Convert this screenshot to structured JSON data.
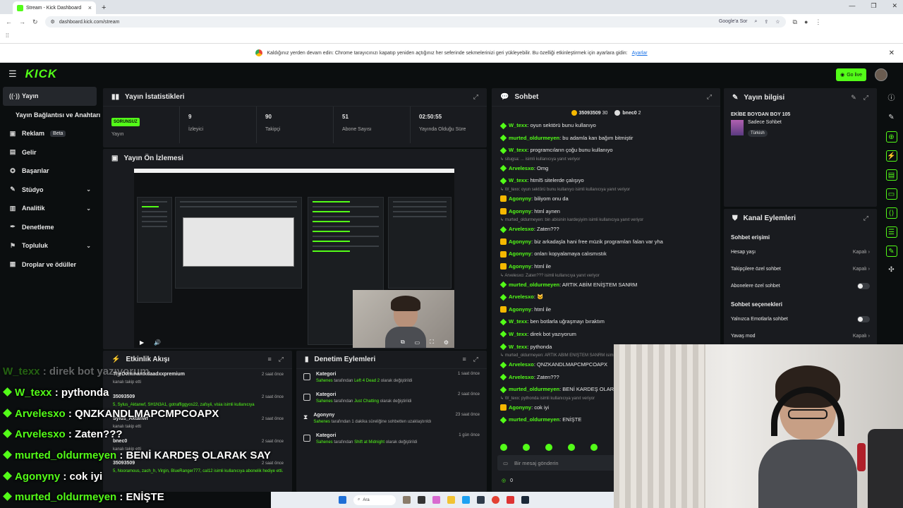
{
  "browser": {
    "tab_title": "Stream - Kick Dashboard",
    "url": "dashboard.kick.com/stream",
    "translate_label": "Google'a Sor",
    "info_text": "Kaldığınız yerden devam edin: Chrome tarayıcınızı kapatıp yeniden açtığınız her seferinde sekmelerinizi geri yükleyebilir. Bu özelliği etkinleştirmek için ayarlara gidin:",
    "info_link": "Ayarlar"
  },
  "topbar": {
    "logo": "KICK",
    "golive_label": "Go live"
  },
  "sidebar": {
    "items": [
      {
        "label": "Yayın",
        "icon": "broadcast-icon"
      },
      {
        "label": "Yayın Bağlantısı ve Anahtarı"
      },
      {
        "label": "Reklam",
        "badge": "Beta",
        "icon": "ads-icon"
      },
      {
        "label": "Gelir",
        "icon": "revenue-icon"
      },
      {
        "label": "Başarılar",
        "icon": "achievements-icon"
      },
      {
        "label": "Stüdyo",
        "icon": "studio-icon"
      },
      {
        "label": "Analitik",
        "icon": "analytics-icon"
      },
      {
        "label": "Denetleme",
        "icon": "moderation-icon"
      },
      {
        "label": "Topluluk",
        "icon": "community-icon"
      },
      {
        "label": "Droplar ve ödüller",
        "icon": "drops-icon"
      }
    ]
  },
  "stats": {
    "title": "Yayın İstatistikleri",
    "badge": "SORUNSUZ",
    "items": [
      {
        "value": "",
        "label": "Yayın"
      },
      {
        "value": "9",
        "label": "İzleyici"
      },
      {
        "value": "90",
        "label": "Takipçi"
      },
      {
        "value": "51",
        "label": "Abone Sayısı"
      },
      {
        "value": "02:50:55",
        "label": "Yayında Olduğu Süre"
      }
    ]
  },
  "preview": {
    "title": "Yayın Ön İzlemesi"
  },
  "activity": {
    "title": "Etkinlik Akışı",
    "events": [
      {
        "name": "TheD0minantxdaadxxpremium",
        "time": "2 saat önce",
        "desc": "kanalı takip etti",
        "green": false
      },
      {
        "name": "35093509",
        "time": "2 saat önce",
        "desc": "5, Sylus_Aktanwf, SH1N3A1, gotraffiggyos22, zafsyii, visia isimli kullanıcıya",
        "green": true
      },
      {
        "name": "Sylus_Aktanwf",
        "time": "2 saat önce",
        "desc": "kanalı takip etti",
        "green": false
      },
      {
        "name": "bnec0",
        "time": "2 saat önce",
        "desc": "kanalı takip etti",
        "green": false
      },
      {
        "name": "35093509",
        "time": "2 saat önce",
        "desc": "5, Nooramous, zach_h, Virgin, BlueRanger777, cal12 isimli kullanıcıya abonelik hediye etti.",
        "green": true
      }
    ]
  },
  "moderation": {
    "title": "Denetim Eylemleri",
    "items": [
      {
        "name": "Kategori",
        "time": "1 saat önce",
        "who": "Sahenes",
        "mid": "tarafından",
        "what": "Left 4 Dead 2",
        "end": "olarak değiştirildi"
      },
      {
        "name": "Kategori",
        "time": "2 saat önce",
        "who": "Sahenes",
        "mid": "tarafından",
        "what": "Just Chatting",
        "end": "olarak değiştirildi"
      },
      {
        "name": "Agonyny",
        "time": "23 saat önce",
        "who": "Sahenes",
        "mid": "tarafından 1 dakika süreliğine sohbetten uzaklaştırıldı",
        "what": "",
        "end": ""
      },
      {
        "name": "Kategori",
        "time": "1 gün önce",
        "who": "Sahenes",
        "mid": "tarafından",
        "what": "Shift at Midnight",
        "end": "olarak değiştirildi"
      }
    ]
  },
  "chat": {
    "title": "Sohbet",
    "top_user1": "35093509",
    "top_count1": "30",
    "top_user2": "bnec0",
    "top_count2": "2",
    "input_placeholder": "Bir mesaj gönderin",
    "points": "0",
    "messages": [
      {
        "user": "W_texx",
        "text": "oyun sektörü bunu kullanıyo",
        "badge": "dia"
      },
      {
        "user": "murted_oldurmeyen",
        "text": "bu adamla kan bağım bitmiştir",
        "badge": "dia"
      },
      {
        "user": "W_texx",
        "text": "programcıların çoğu bunu kullanıyo",
        "badge": "dia"
      },
      {
        "reply": "situgsa: ... isimli kullanıcıya yanıt veriyor"
      },
      {
        "user": "Arvelesxo",
        "text": "Omg",
        "badge": "dia"
      },
      {
        "user": "W_texx",
        "text": "html5 sitelerde çalışıyo",
        "badge": "dia"
      },
      {
        "reply": "W_texx: oyun sektörü bunu kullanıyo isimli kullanıcıya yanıt veriyor"
      },
      {
        "user": "Agonyny",
        "text": "biliyom onu da",
        "badge": "box"
      },
      {
        "user": "Agonyny",
        "text": "html aynen",
        "badge": "box"
      },
      {
        "reply": "murted_oldurmeyen: bin abisinin kardeşiyim isimli kullanıcıya yanıt veriyor"
      },
      {
        "user": "Arvelesxo",
        "text": "Zaten???",
        "badge": "dia"
      },
      {
        "user": "Agonyny",
        "text": "biz arkadaşla hani free müzik programları falan var yha",
        "badge": "box"
      },
      {
        "user": "Agonyny",
        "text": "onları kopyalamaya calısmıstık",
        "badge": "box"
      },
      {
        "user": "Agonyny",
        "text": "html ile",
        "badge": "box"
      },
      {
        "reply": "Arvelesxo: Zaten??? isimli kullanıcıya yanıt veriyor"
      },
      {
        "user": "murted_oldurmeyen",
        "text": "ARTIK ABİM ENİŞTEM SANRM",
        "badge": "dia"
      },
      {
        "user": "Arvelesxo",
        "text": "🐱",
        "badge": "dia"
      },
      {
        "user": "Agonyny",
        "text": "html ile",
        "badge": "box"
      },
      {
        "user": "W_texx",
        "text": "ben botlarla uğraşmayı bıraktım",
        "badge": "dia"
      },
      {
        "user": "W_texx",
        "text": "direk bot yazıyorum",
        "badge": "dia"
      },
      {
        "user": "W_texx",
        "text": "pythonda",
        "badge": "dia"
      },
      {
        "reply": "murted_oldurmeyen: ARTIK ABİM ENİŞTEM SANRM isimli kullanıcıya yanıt veriyor"
      },
      {
        "user": "Arvelesxo",
        "text": "QNZKANDLMAPCMPCOAPX",
        "badge": "dia"
      },
      {
        "user": "Arvelesxo",
        "text": "Zaten???",
        "badge": "dia"
      },
      {
        "user": "murted_oldurmeyen",
        "text": "BENİ KARDEŞ OLARAK SAY",
        "badge": "dia"
      },
      {
        "reply": "W_texx: pythonda isimli kullanıcıya yanıt veriyor"
      },
      {
        "user": "Agonyny",
        "text": "cok iyi",
        "badge": "box"
      },
      {
        "user": "murted_oldurmeyen",
        "text": "ENİŞTE",
        "badge": "dia"
      }
    ]
  },
  "stream_info": {
    "title": "Yayın bilgisi",
    "stream_title": "EKİBE BOYDAN BOY 105",
    "category": "Sadece Sohbet",
    "language": "Türkish"
  },
  "channel_actions": {
    "title": "Kanal Eylemleri",
    "section1": "Sohbet erişimi",
    "rows1": [
      {
        "label": "Hesap yaşı",
        "value": "Kapalı",
        "type": "value"
      },
      {
        "label": "Takipçilere özel sohbet",
        "value": "Kapalı",
        "type": "value"
      },
      {
        "label": "Abonelere özel sohbet",
        "value": "",
        "type": "toggle"
      }
    ],
    "section2": "Sohbet seçenekleri",
    "rows2": [
      {
        "label": "Yalnızca Emotlarla sohbet",
        "value": "",
        "type": "toggle"
      },
      {
        "label": "Yavaş mod",
        "value": "Kapalı",
        "type": "value"
      }
    ]
  },
  "overlay": {
    "lines": [
      {
        "user": "W_texx",
        "text": ": direk bot yazıyorum",
        "faded": true
      },
      {
        "user": "W_texx",
        "text": ": pythonda",
        "faded": false
      },
      {
        "user": "Arvelesxo",
        "text": ": QNZKANDLMAPCMPCOAPX",
        "faded": false
      },
      {
        "user": "Arvelesxo",
        "text": ": Zaten???",
        "faded": false
      },
      {
        "user": "murted_oldurmeyen",
        "text": ": BENİ KARDEŞ OLARAK SAY",
        "faded": false
      },
      {
        "user": "Agonyny",
        "text": ": cok iyi",
        "faded": false
      },
      {
        "user": "murted_oldurmeyen",
        "text": ": ENİŞTE",
        "faded": false
      }
    ]
  },
  "taskbar": {
    "search_label": "Ara"
  },
  "colors": {
    "accent": "#53fc18",
    "panel": "#191b1f",
    "background": "#0b0e0f"
  }
}
